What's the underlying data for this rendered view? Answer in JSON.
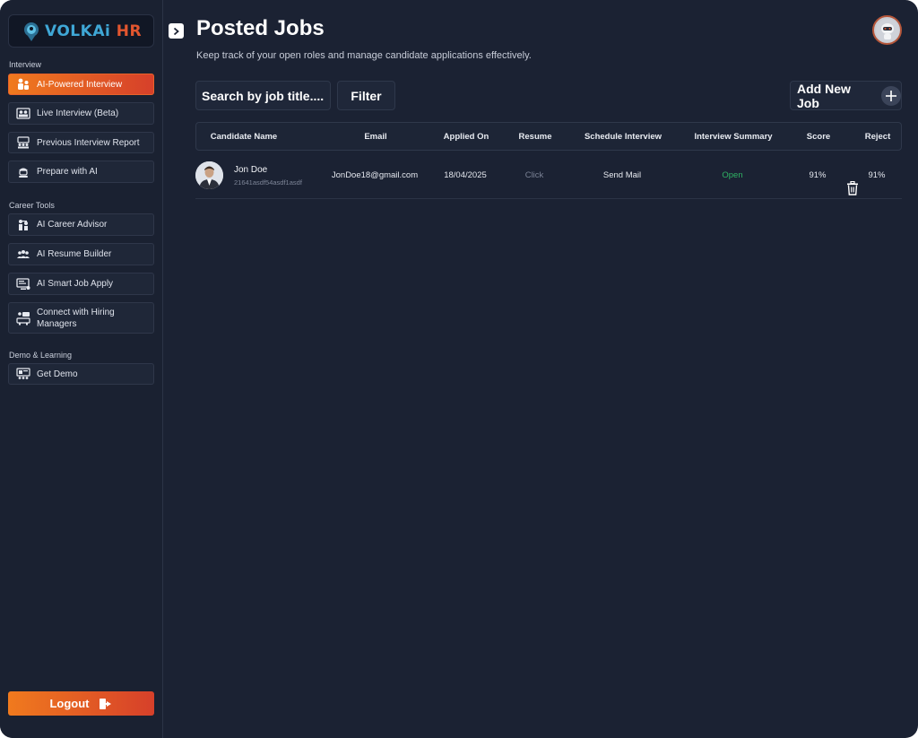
{
  "app": {
    "logo_text_a": "VOLKAi",
    "logo_text_b": "HR",
    "colors": {
      "accent_start": "#f07a1e",
      "accent_end": "#d6402a",
      "status_green": "#2fb364",
      "bg": "#1b2233"
    }
  },
  "sidebar": {
    "sections": [
      {
        "label": "Interview"
      },
      {
        "label": "Career Tools"
      },
      {
        "label": "Demo & Learning"
      }
    ],
    "items": [
      {
        "label": "AI-Powered Interview",
        "icon": "interview-people-icon"
      },
      {
        "label": "Live Interview (Beta)",
        "icon": "video-call-icon"
      },
      {
        "label": "Previous Interview Report",
        "icon": "report-group-icon"
      },
      {
        "label": "Prepare with AI",
        "icon": "robot-helper-icon"
      },
      {
        "label": "AI Career Advisor",
        "icon": "advisor-icon"
      },
      {
        "label": "AI Resume Builder",
        "icon": "team-icon"
      },
      {
        "label": "AI Smart Job Apply",
        "icon": "monitor-icon"
      },
      {
        "label": "Connect with Hiring Managers",
        "icon": "meeting-icon"
      },
      {
        "label": "Get Demo",
        "icon": "presentation-icon"
      }
    ],
    "logout_label": "Logout"
  },
  "header": {
    "title": "Posted Jobs",
    "subtitle": "Keep track of your open roles and manage candidate applications effectively."
  },
  "toolbar": {
    "search_placeholder": "Search by job title....",
    "filter_label": "Filter",
    "add_job_label": "Add New Job"
  },
  "table": {
    "columns": [
      "Candidate Name",
      "Email",
      "Applied On",
      "Resume",
      "Schedule Interview",
      "Interview Summary",
      "Score",
      "Reject"
    ],
    "rows": [
      {
        "name": "Jon Doe",
        "id": "21641asdf54asdf1asdf",
        "email": "JonDoe18@gmail.com",
        "applied_on": "18/04/2025",
        "resume": "Click",
        "schedule": "Send Mail",
        "summary": "Open",
        "score": "91%",
        "reject": "91%"
      }
    ]
  }
}
